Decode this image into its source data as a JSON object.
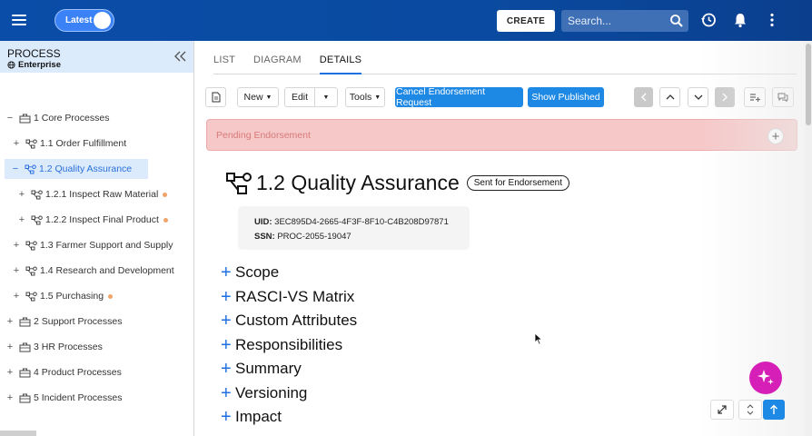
{
  "header": {
    "toggle_label": "Latest",
    "create_label": "CREATE",
    "search_placeholder": "Search..."
  },
  "sidebar": {
    "title": "PROCESS",
    "subtitle": "Enterprise",
    "items": [
      {
        "label": "1 Core Processes",
        "exp": "−"
      },
      {
        "label": "1.1 Order Fulfillment",
        "exp": "+"
      },
      {
        "label": "1.2 Quality Assurance",
        "exp": "−"
      },
      {
        "label": "1.2.1 Inspect Raw Material",
        "exp": "+"
      },
      {
        "label": "1.2.2 Inspect Final Product",
        "exp": "+"
      },
      {
        "label": "1.3 Farmer Support and Supply",
        "exp": "+"
      },
      {
        "label": "1.4 Research and Development",
        "exp": "+"
      },
      {
        "label": "1.5 Purchasing",
        "exp": "+"
      },
      {
        "label": "2 Support Processes",
        "exp": "+"
      },
      {
        "label": "3 HR Processes",
        "exp": "+"
      },
      {
        "label": "4 Product Processes",
        "exp": "+"
      },
      {
        "label": "5 Incident Processes",
        "exp": "+"
      }
    ]
  },
  "tabs": [
    {
      "label": "LIST"
    },
    {
      "label": "DIAGRAM"
    },
    {
      "label": "DETAILS"
    }
  ],
  "toolbar": {
    "new_label": "New",
    "edit_label": "Edit",
    "tools_label": "Tools",
    "cancel_endorsement_label": "Cancel Endorsement Request",
    "show_published_label": "Show Published"
  },
  "pending": {
    "text": "Pending Endorsement"
  },
  "detail": {
    "title": "1.2 Quality Assurance",
    "status": "Sent for Endorsement",
    "uid_label": "UID:",
    "uid_value": "3EC895D4-2665-4F3F-8F10-C4B208D97871",
    "ssn_label": "SSN:",
    "ssn_value": "PROC-2055-19047"
  },
  "sections": [
    {
      "label": "Scope"
    },
    {
      "label": "RASCI-VS Matrix"
    },
    {
      "label": "Custom Attributes"
    },
    {
      "label": "Responsibilities"
    },
    {
      "label": "Summary"
    },
    {
      "label": "Versioning"
    },
    {
      "label": "Impact"
    }
  ],
  "colors": {
    "topbar": "#0a4da8",
    "accent": "#1e88e5",
    "pending_bg": "#f6c8c8",
    "ai_button": "#d61fb6"
  }
}
